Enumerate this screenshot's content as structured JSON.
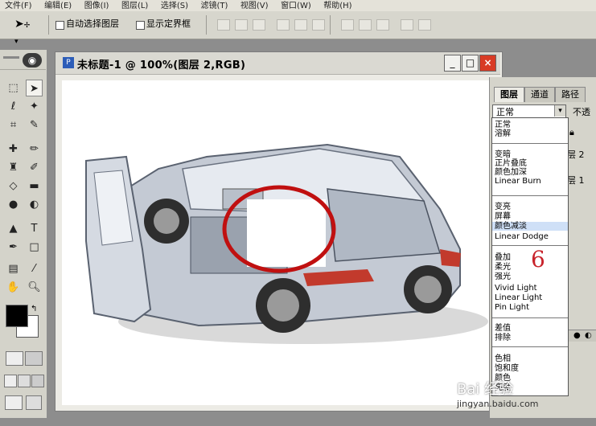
{
  "menubar": {
    "items": [
      "文件(F)",
      "编辑(E)",
      "图像(I)",
      "图层(L)",
      "选择(S)",
      "滤镜(T)",
      "视图(V)",
      "窗口(W)",
      "帮助(H)"
    ]
  },
  "options_bar": {
    "tool_icon": "move-tool-icon",
    "auto_select_label": "自动选择图层",
    "show_transform_label": "显示定界框"
  },
  "toolbox": {
    "tools": [
      "marquee",
      "move",
      "lasso",
      "magic-wand",
      "crop",
      "slice",
      "healing",
      "brush",
      "stamp",
      "history-brush",
      "eraser",
      "gradient",
      "blur",
      "dodge",
      "path-select",
      "type",
      "pen",
      "shape",
      "notes",
      "eyedropper",
      "hand",
      "zoom"
    ],
    "foreground_color": "#000000",
    "background_color": "#ffffff"
  },
  "document": {
    "title": "未标题-1 @ 100%(图层 2,RGB)",
    "controls": [
      "_",
      "□",
      "×"
    ],
    "close_color": "#d83b25"
  },
  "layers_panel": {
    "tabs": [
      "图层",
      "通道",
      "路径"
    ],
    "blend_mode_value": "正常",
    "opacity_label": "不透",
    "layer_rows": [
      "层 2",
      "层 1"
    ],
    "blend_modes": [
      [
        "正常",
        "溶解"
      ],
      [
        "变暗",
        "正片叠底",
        "颜色加深",
        "Linear Burn"
      ],
      [
        "变亮",
        "屏幕",
        "颜色减淡",
        "Linear Dodge"
      ],
      [
        "叠加",
        "柔光",
        "强光",
        "Vivid Light",
        "Linear Light",
        "Pin Light"
      ],
      [
        "差值",
        "排除"
      ],
      [
        "色相",
        "饱和度",
        "颜色",
        "亮度"
      ]
    ],
    "highlighted_mode": "颜色减淡",
    "annotation_number": "6",
    "annotation_color": "#c8232b"
  },
  "watermark": {
    "text": "Bai 经验",
    "url": "jingyan.baidu.com"
  }
}
